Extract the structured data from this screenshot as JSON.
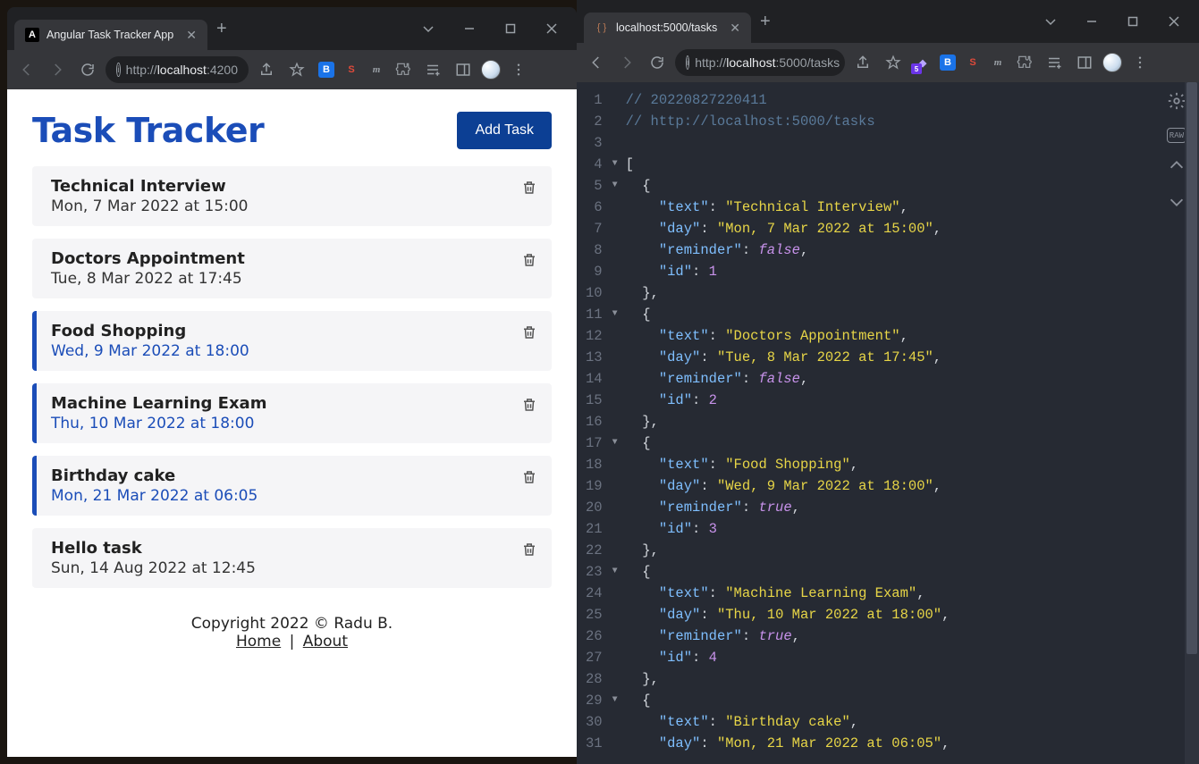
{
  "left_window": {
    "tab_title": "Angular Task Tracker App",
    "url_prefix": "http://",
    "url_host": "localhost",
    "url_suffix": ":4200"
  },
  "right_window": {
    "tab_title": "localhost:5000/tasks",
    "url_prefix": "http://",
    "url_host": "localhost",
    "url_suffix": ":5000/tasks",
    "ext_badge": "5"
  },
  "app": {
    "title": "Task Tracker",
    "add_button": "Add Task",
    "tasks": [
      {
        "text": "Technical Interview",
        "day": "Mon, 7 Mar 2022 at 15:00",
        "reminder": false
      },
      {
        "text": "Doctors Appointment",
        "day": "Tue, 8 Mar 2022 at 17:45",
        "reminder": false
      },
      {
        "text": "Food Shopping",
        "day": "Wed, 9 Mar 2022 at 18:00",
        "reminder": true
      },
      {
        "text": "Machine Learning Exam",
        "day": "Thu, 10 Mar 2022 at 18:00",
        "reminder": true
      },
      {
        "text": "Birthday cake",
        "day": "Mon, 21 Mar 2022 at 06:05",
        "reminder": true
      },
      {
        "text": "Hello task",
        "day": "Sun, 14 Aug 2022 at 12:45",
        "reminder": false
      }
    ],
    "footer_copyright": "Copyright 2022 © Radu B.",
    "footer_home": "Home",
    "footer_sep": "|",
    "footer_about": "About"
  },
  "json_viewer": {
    "comment1": "// 20220827220411",
    "comment2": "// http://localhost:5000/tasks",
    "lines": 31,
    "api_tasks": [
      {
        "text": "Technical Interview",
        "day": "Mon, 7 Mar 2022 at 15:00",
        "reminder": false,
        "id": 1
      },
      {
        "text": "Doctors Appointment",
        "day": "Tue, 8 Mar 2022 at 17:45",
        "reminder": false,
        "id": 2
      },
      {
        "text": "Food Shopping",
        "day": "Wed, 9 Mar 2022 at 18:00",
        "reminder": true,
        "id": 3
      },
      {
        "text": "Machine Learning Exam",
        "day": "Thu, 10 Mar 2022 at 18:00",
        "reminder": true,
        "id": 4
      },
      {
        "text": "Birthday cake",
        "day": "Mon, 21 Mar 2022 at 06:05"
      }
    ]
  }
}
